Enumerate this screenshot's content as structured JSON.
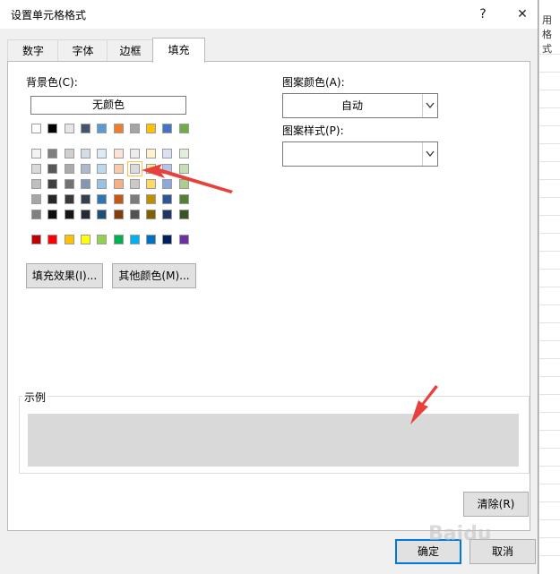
{
  "window": {
    "title": "设置单元格格式",
    "help_label": "?",
    "close_label": "✕"
  },
  "tabs": [
    {
      "label": "数字",
      "active": false
    },
    {
      "label": "字体",
      "active": false
    },
    {
      "label": "边框",
      "active": false
    },
    {
      "label": "填充",
      "active": true
    }
  ],
  "background_color": {
    "label": "背景色(C):",
    "no_color_label": "无颜色",
    "theme_top_row": [
      "#ffffff",
      "#000000",
      "#e7e6e6",
      "#44546a",
      "#5b9bd5",
      "#ed7d31",
      "#a5a5a5",
      "#ffc000",
      "#4472c4",
      "#70ad47"
    ],
    "theme_shades": [
      [
        "#f2f2f2",
        "#7f7f7f",
        "#d0cece",
        "#d6dce4",
        "#ddebf7",
        "#fbe4d5",
        "#ededed",
        "#fff2cc",
        "#d9e1f2",
        "#e2efda"
      ],
      [
        "#d9d9d9",
        "#595959",
        "#aeaaaa",
        "#adb9ca",
        "#bdd7ee",
        "#f8cbad",
        "#dbdbdb",
        "#ffe699",
        "#b4c6e7",
        "#c6e0b4"
      ],
      [
        "#bfbfbf",
        "#404040",
        "#757171",
        "#8497b0",
        "#9bc2e6",
        "#f4b084",
        "#c9c9c9",
        "#ffd966",
        "#8ea9db",
        "#a9d08e"
      ],
      [
        "#a6a6a6",
        "#262626",
        "#3a3838",
        "#333f4f",
        "#2f75b5",
        "#c65911",
        "#7b7b7b",
        "#bf8f00",
        "#2f5597",
        "#548235"
      ],
      [
        "#808080",
        "#0d0d0d",
        "#161616",
        "#222b35",
        "#1f4e78",
        "#833c0c",
        "#525252",
        "#806000",
        "#203764",
        "#375623"
      ]
    ],
    "standard_colors": [
      "#c00000",
      "#ff0000",
      "#ffc000",
      "#ffff00",
      "#92d050",
      "#00b050",
      "#00b0f0",
      "#0070c0",
      "#002060",
      "#7030a0"
    ],
    "selected_color": "#ededed"
  },
  "buttons": {
    "fill_effects": "填充效果(I)...",
    "more_colors": "其他颜色(M)...",
    "clear": "清除(R)",
    "ok": "确定",
    "cancel": "取消"
  },
  "pattern_color": {
    "label": "图案颜色(A):",
    "value": "自动"
  },
  "pattern_style": {
    "label": "图案样式(P):",
    "value": ""
  },
  "sample": {
    "label": "示例",
    "fill_color": "#d9d9d9"
  },
  "background_sheet": {
    "fragments": [
      "用",
      "格式"
    ]
  },
  "watermark": "Baidu"
}
